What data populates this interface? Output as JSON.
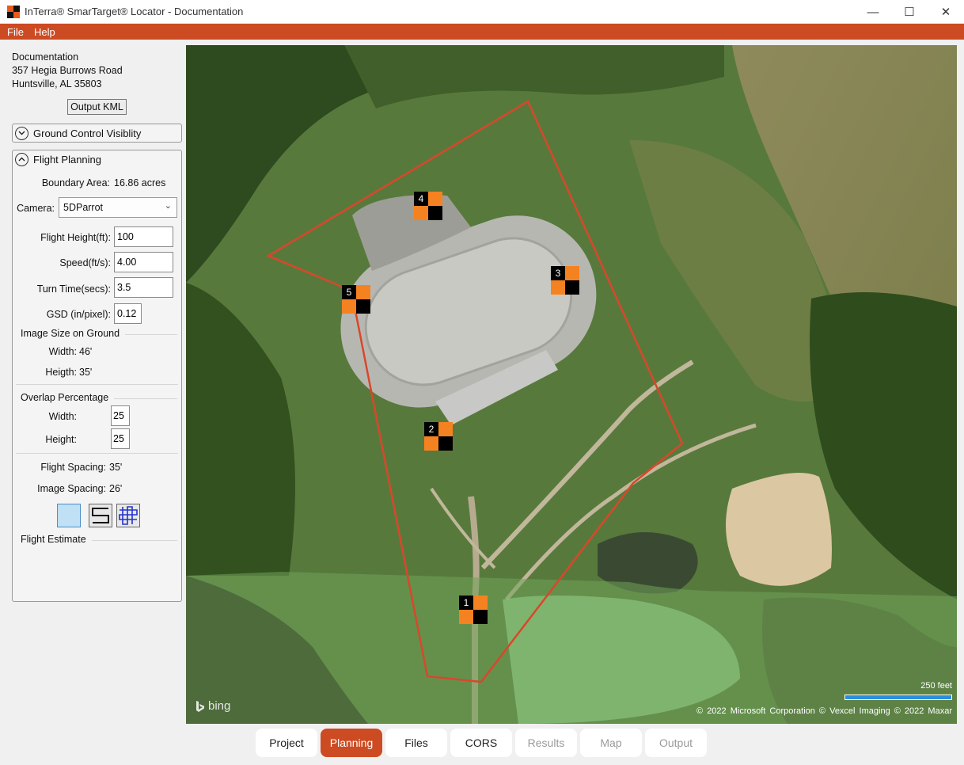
{
  "window": {
    "title": "InTerra® SmarTarget® Locator - Documentation",
    "minimize_glyph": "—",
    "maximize_glyph": "☐",
    "close_glyph": "✕"
  },
  "menu": [
    "File",
    "Help"
  ],
  "project": {
    "name": "Documentation",
    "address_line1": "357 Hegia Burrows Road",
    "address_line2": "Huntsville, AL 35803"
  },
  "output_kml_label": "Output KML",
  "ground_control": {
    "title": "Ground Control Visiblity",
    "icon": "chevron-down-circle-icon"
  },
  "flight_planning": {
    "title": "Flight Planning",
    "icon": "chevron-up-circle-icon",
    "boundary_area_label": "Boundary Area:",
    "boundary_area_value": "16.86 acres",
    "camera_label": "Camera:",
    "camera_value": "5DParrot",
    "flight_height_label": "Flight Height(ft):",
    "flight_height_value": "100",
    "speed_label": "Speed(ft/s):",
    "speed_value": "4.00",
    "turn_time_label": "Turn Time(secs):",
    "turn_time_value": "3.5",
    "gsd_label": "GSD (in/pixel):",
    "gsd_value": "0.12",
    "image_size_title": "Image Size on Ground",
    "image_width_label": "Width:",
    "image_width_value": "46'",
    "image_height_label": "Heigth:",
    "image_height_value": "35'",
    "overlap_title": "Overlap Percentage",
    "overlap_width_label": "Width:",
    "overlap_width_value": "25",
    "overlap_height_label": "Height:",
    "overlap_height_value": "25",
    "flight_spacing_label": "Flight Spacing:",
    "flight_spacing_value": "35'",
    "image_spacing_label": "Image Spacing:",
    "image_spacing_value": "26'",
    "pattern_buttons": [
      "no-pattern-icon",
      "serpentine-pattern-icon",
      "grid-pattern-icon"
    ],
    "estimate_title": "Flight Estimate"
  },
  "map": {
    "markers": [
      "1",
      "2",
      "3",
      "4",
      "5"
    ],
    "bing_label": "bing",
    "scale_label": "250 feet",
    "copyright": "© 2022 Microsoft Corporation   © Vexcel Imaging   © 2022 Maxar",
    "boundary_color": "#d9472b",
    "marker_color": "#f58220"
  },
  "tabs": [
    {
      "label": "Project",
      "state": "normal"
    },
    {
      "label": "Planning",
      "state": "active"
    },
    {
      "label": "Files",
      "state": "normal"
    },
    {
      "label": "CORS",
      "state": "normal"
    },
    {
      "label": "Results",
      "state": "disabled"
    },
    {
      "label": "Map",
      "state": "disabled"
    },
    {
      "label": "Output",
      "state": "disabled"
    }
  ]
}
